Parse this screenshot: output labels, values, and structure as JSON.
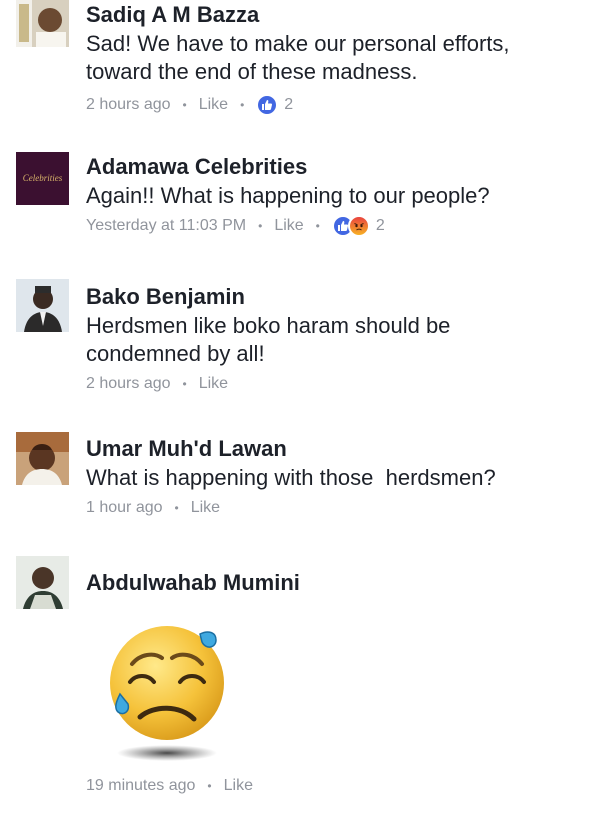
{
  "comments": [
    {
      "author": "Sadiq A M Bazza",
      "text": "Sad! We have to make our personal efforts, toward the end of these madness.",
      "time": "2 hours ago",
      "like_label": "Like",
      "reaction_count": "2",
      "reactions": [
        "like"
      ]
    },
    {
      "author": "Adamawa Celebrities",
      "avatar_text": "Celebrities",
      "text": "Again!! What is happening to our people?",
      "time": "Yesterday at 11:03 PM",
      "like_label": "Like",
      "reaction_count": "2",
      "reactions": [
        "like",
        "angry"
      ]
    },
    {
      "author": "Bako Benjamin",
      "text": "Herdsmen like boko haram should be condemned by all!",
      "time": "2 hours ago",
      "like_label": "Like"
    },
    {
      "author": "Umar Muh'd Lawan",
      "text": "What is happening with those  herdsmen?",
      "time": "1 hour ago",
      "like_label": "Like"
    },
    {
      "author": "Abdulwahab Mumini",
      "sticker": "crying-face-sticker",
      "time": "19 minutes ago",
      "like_label": "Like"
    }
  ],
  "colors": {
    "like_blue": "#4267e2",
    "meta_gray": "#90949c",
    "text_dark": "#1d2129"
  }
}
